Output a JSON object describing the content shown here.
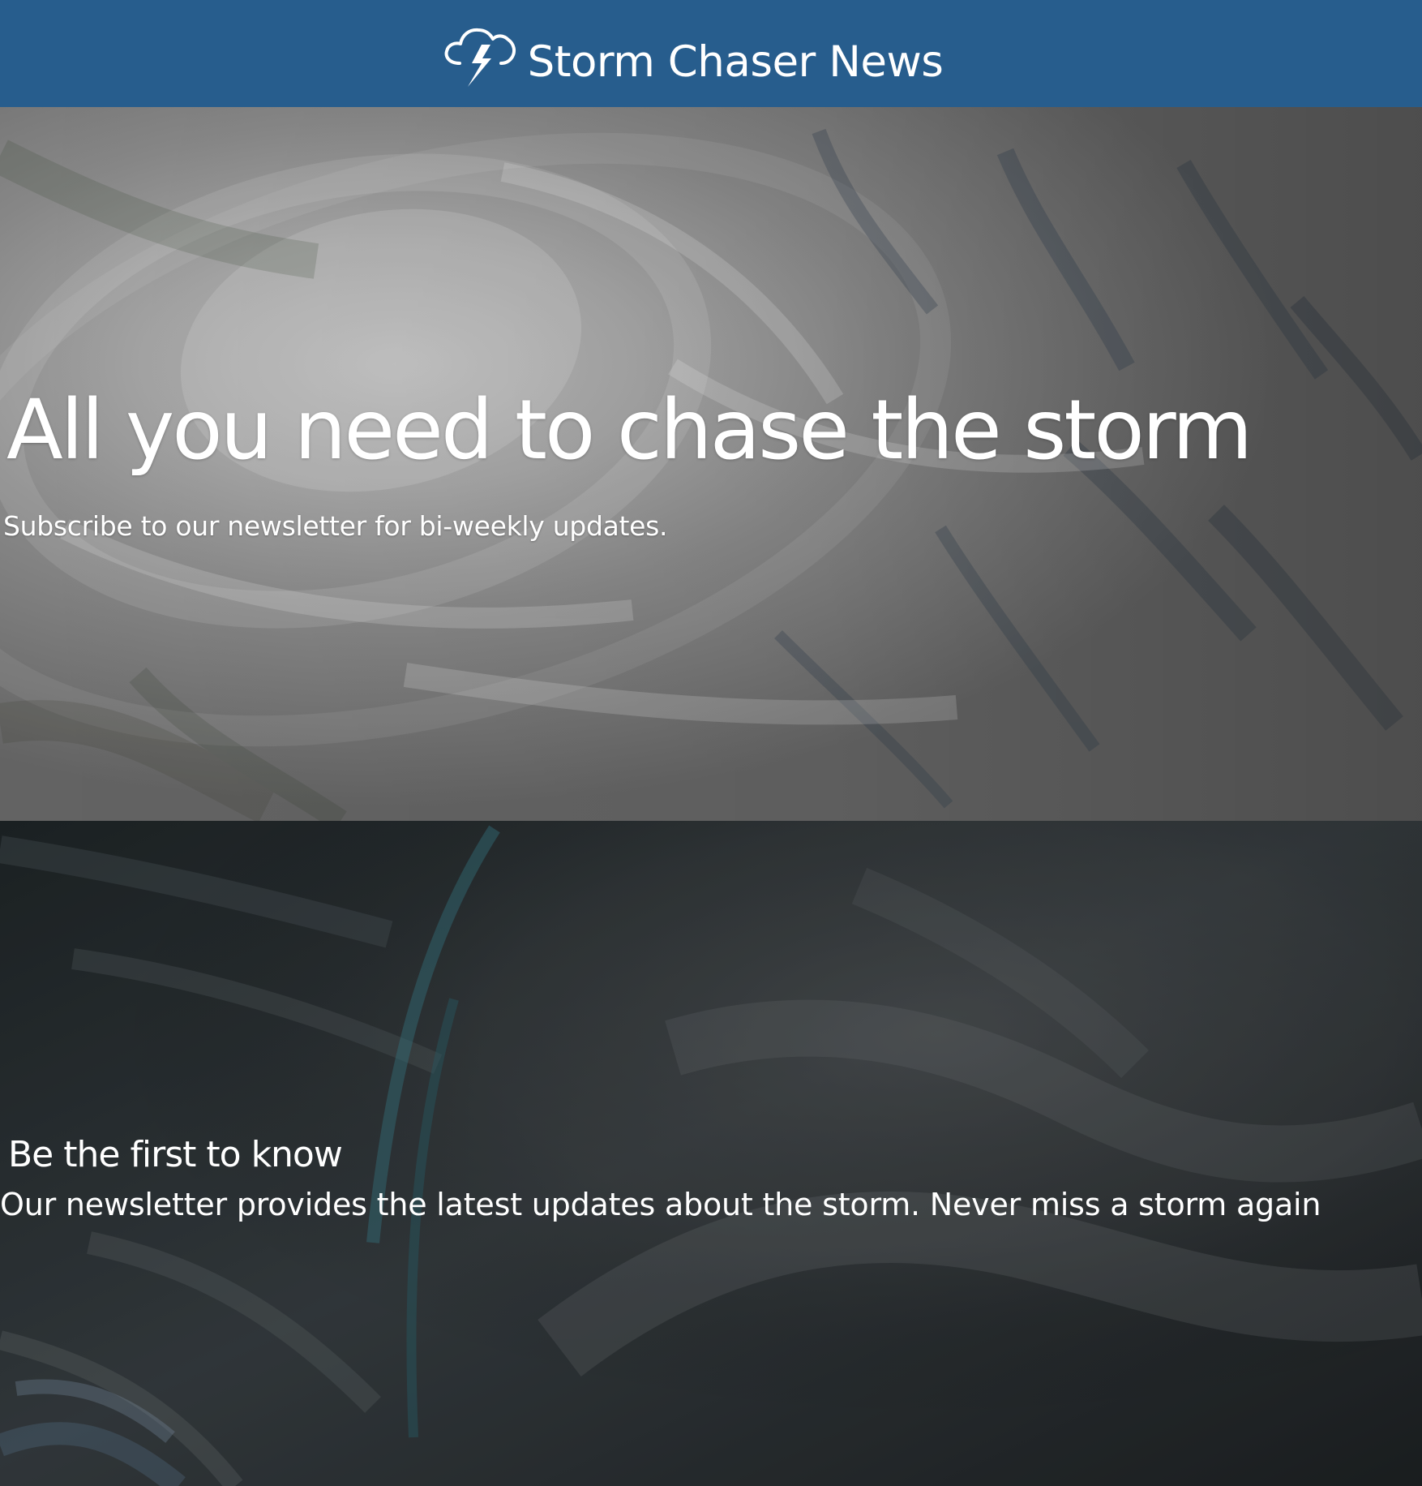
{
  "header": {
    "brand_icon": "storm-cloud-lightning-icon",
    "title": "Storm Chaser News"
  },
  "hero": {
    "title": "All you need to chase the storm",
    "subtitle": "Subscribe to our newsletter for bi-weekly updates."
  },
  "section": {
    "title": "Be the first to know",
    "text": "Our newsletter provides the latest updates about the storm. Never miss a storm again"
  },
  "colors": {
    "header_bg": "#275d8d",
    "text": "#ffffff",
    "hero_base": "#737373",
    "section_base": "#262d30"
  }
}
